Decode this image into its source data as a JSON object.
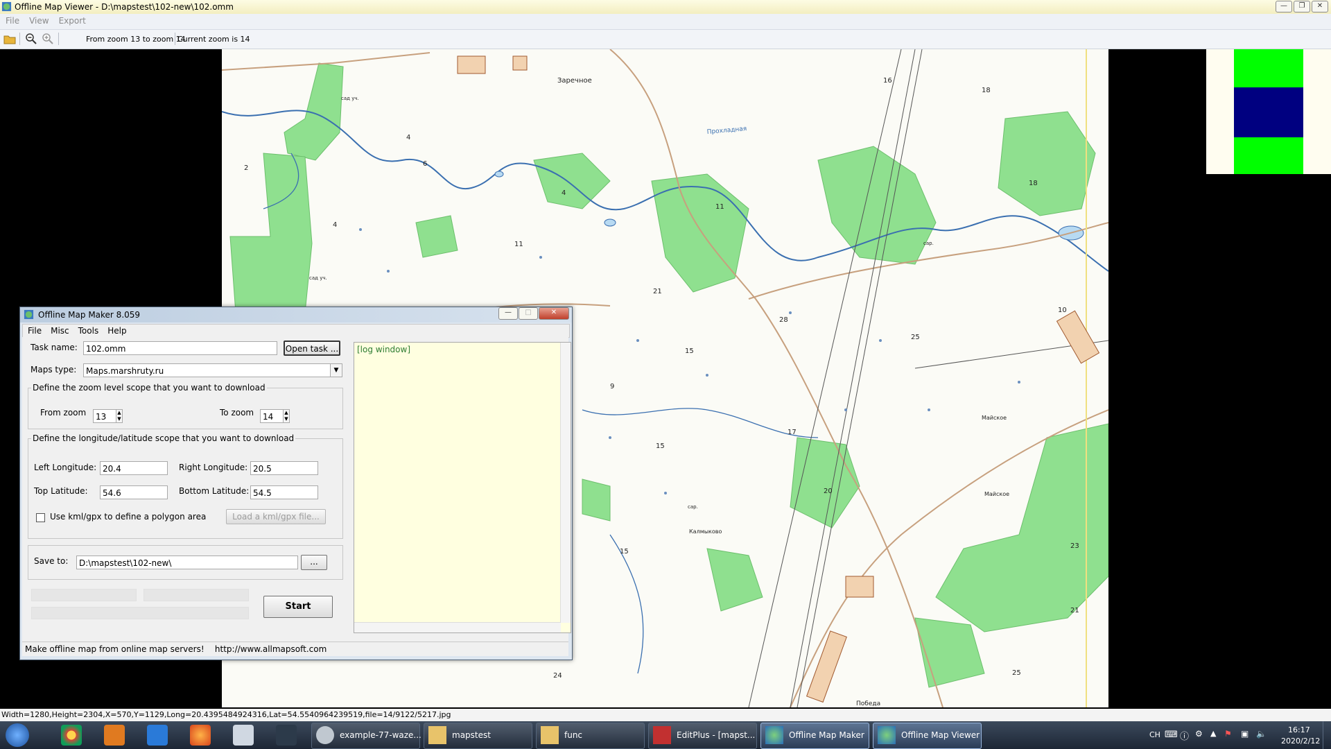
{
  "viewer": {
    "title": "Offline Map Viewer - D:\\mapstest\\102-new\\102.omm",
    "menu": [
      "File",
      "View",
      "Export"
    ],
    "zoom_range_text": "From zoom 13 to zoom 14",
    "current_zoom_text": "Current zoom is 14",
    "status_text": "Width=1280,Height=2304,X=570,Y=1129,Long=20.4395484924316,Lat=54.5540964239519,file=14/9122/5217.jpg"
  },
  "map_labels": {
    "village1": "Заречное",
    "village2": "Майское",
    "village3": "Майское",
    "village4": "Калмыково",
    "village5": "Победа",
    "river": "Прохладная",
    "sad_uch1": "сад уч.",
    "sad_uch2": "сад уч.",
    "sar1": "сар.",
    "sar2": "сар.",
    "n2": "2",
    "n4a": "4",
    "n4b": "4",
    "n4c": "4",
    "n6": "6",
    "n11a": "11",
    "n11b": "11",
    "n16": "16",
    "n18a": "18",
    "n18b": "18",
    "n21a": "21",
    "n21b": "21",
    "n28": "28",
    "n25a": "25",
    "n15a": "15",
    "n15b": "15",
    "n15c": "15",
    "n9": "9",
    "n17": "17",
    "n20": "20",
    "n10": "10",
    "n23": "23",
    "n24": "24",
    "n25b": "25"
  },
  "minimap_colors": {
    "top": "#00ff00",
    "middle": "#000080",
    "bottom": "#00ff00"
  },
  "maker": {
    "title": "Offline Map Maker 8.059",
    "menu": [
      "File",
      "Misc",
      "Tools",
      "Help"
    ],
    "task_label": "Task name:",
    "task_value": "102.omm",
    "open_task": "Open task ...",
    "maps_type_label": "Maps type:",
    "maps_type_value": "Maps.marshruty.ru",
    "zoom_group": "Define the zoom level scope that you want to download",
    "from_zoom_label": "From zoom",
    "from_zoom_value": "13",
    "to_zoom_label": "To zoom",
    "to_zoom_value": "14",
    "lonlat_group": "Define the longitude/latitude scope that you want to download",
    "left_lon_label": "Left Longitude:",
    "left_lon_value": "20.4",
    "right_lon_label": "Right Longitude:",
    "right_lon_value": "20.5",
    "top_lat_label": "Top Latitude:",
    "top_lat_value": "54.6",
    "bottom_lat_label": "Bottom Latitude:",
    "bottom_lat_value": "54.5",
    "kml_label": "Use kml/gpx to define a polygon area",
    "load_kml": "Load a kml/gpx file...",
    "save_label": "Save to:",
    "save_value": "D:\\mapstest\\102-new\\",
    "browse": "...",
    "start": "Start",
    "log_text": "[log window]",
    "status_text": "Make offline map from online map servers!    http://www.allmapsoft.com"
  },
  "taskbar": {
    "items": [
      "example-77-waze...",
      "mapstest",
      "func",
      "EditPlus - [mapst...",
      "Offline Map Maker",
      "Offline Map Viewer"
    ],
    "lang": "CH",
    "time": "16:17",
    "date": "2020/2/12"
  }
}
